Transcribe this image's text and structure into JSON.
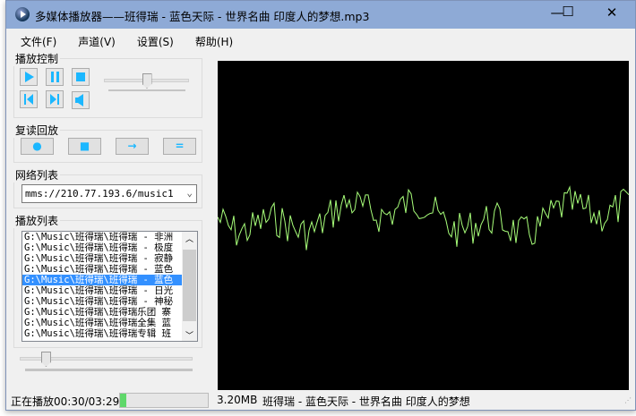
{
  "window": {
    "title": "多媒体播放器——班得瑞 - 蓝色天际 - 世界名曲 印度人的梦想.mp3",
    "minimize": "—",
    "maximize": "☐",
    "close": "✕"
  },
  "menu": [
    "文件(F)",
    "声道(V)",
    "设置(S)",
    "帮助(H)"
  ],
  "playback": {
    "label": "播放控制",
    "volume": 0.5
  },
  "repeat": {
    "label": "复读回放",
    "buttons": [
      "●",
      "■",
      "→",
      "="
    ]
  },
  "network": {
    "label": "网络列表",
    "selected": "mms://210.77.193.6/music1"
  },
  "playlist": {
    "label": "播放列表",
    "selected_index": 4,
    "items": [
      "G:\\Music\\班得瑞\\班得瑞 - 非洲",
      "G:\\Music\\班得瑞\\班得瑞 - 极度",
      "G:\\Music\\班得瑞\\班得瑞 - 寂静",
      "G:\\Music\\班得瑞\\班得瑞 - 蓝色",
      "G:\\Music\\班得瑞\\班得瑞 - 蓝色",
      "G:\\Music\\班得瑞\\班得瑞 - 日光",
      "G:\\Music\\班得瑞\\班得瑞 - 神秘",
      "G:\\Music\\班得瑞\\班得瑞乐团 寨",
      "G:\\Music\\班得瑞\\班得瑞全集 蓝",
      "G:\\Music\\班得瑞\\班得瑞专辑 班"
    ]
  },
  "seek": {
    "position": 0.15
  },
  "status": {
    "playing": "正在播放00:30/03:29",
    "progress": 0.07,
    "size": "3.20MB",
    "track": "班得瑞 - 蓝色天际 - 世界名曲 印度人的梦想"
  },
  "colors": {
    "titlebar": "#8eaad6",
    "waveform": "#a8ff7a",
    "accent": "#1bb7ff",
    "selection": "#3390ff"
  }
}
